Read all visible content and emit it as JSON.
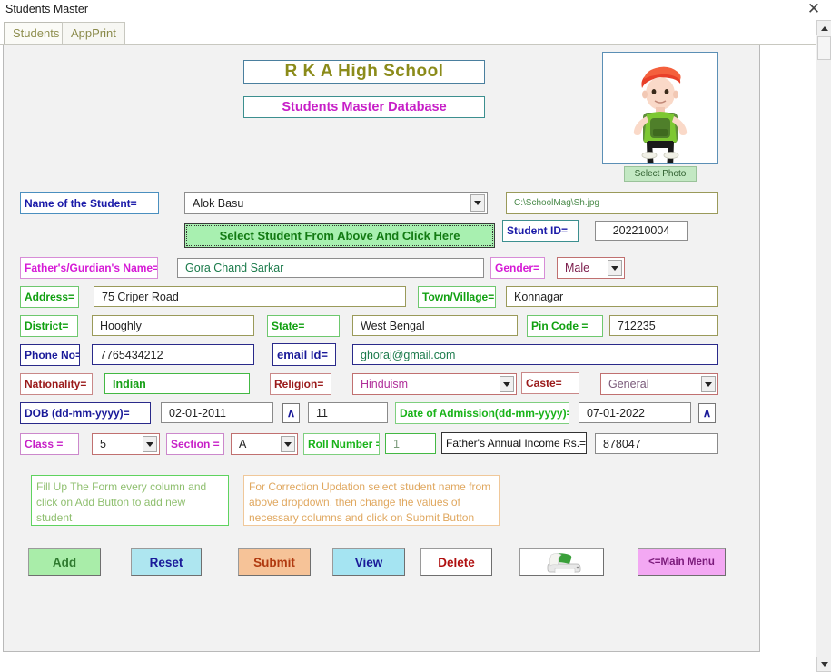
{
  "window": {
    "title": "Students Master",
    "close_icon": "close-icon"
  },
  "tabs": [
    {
      "label": "Students",
      "active": true
    },
    {
      "label": "AppPrint",
      "active": false
    }
  ],
  "header": {
    "school_name": "R K A High School",
    "subtitle": "Students Master Database"
  },
  "photo": {
    "select_photo_label": "Select Photo",
    "path_value": "C:\\SchoolMag\\Sh.jpg"
  },
  "form": {
    "name_label": "Name of the Student=",
    "name_value": "Alok Basu",
    "select_student_button": "Select Student From Above And Click Here",
    "student_id_label": "Student ID=",
    "student_id_value": "202210004",
    "father_label": "Father's/Gurdian's Name=",
    "father_value": "Gora Chand Sarkar",
    "gender_label": "Gender=",
    "gender_value": "Male",
    "address_label": "Address=",
    "address_value": "75 Criper Road",
    "town_label": "Town/Village=",
    "town_value": "Konnagar",
    "district_label": "District=",
    "district_value": "Hooghly",
    "state_label": "State=",
    "state_value": "West Bengal",
    "pin_label": "Pin Code =",
    "pin_value": "712235",
    "phone_label": "Phone No=",
    "phone_value": "7765434212",
    "email_label": "email Id=",
    "email_value": "ghoraj@gmail.com",
    "nationality_label": "Nationality=",
    "nationality_value": "Indian",
    "religion_label": "Religion=",
    "religion_value": "Hinduism",
    "caste_label": "Caste=",
    "caste_value": "General",
    "dob_label": "DOB (dd-mm-yyyy)=",
    "dob_value": "02-01-2011",
    "dob_picker_icon": "∧",
    "age_value": "11",
    "admission_label": "Date of Admission(dd-mm-yyyy)=",
    "admission_value": "07-01-2022",
    "admission_picker_icon": "∧",
    "class_label": "Class =",
    "class_value": "5",
    "section_label": "Section =",
    "section_value": "A",
    "roll_label": "Roll Number =",
    "roll_value": "1",
    "income_label": "Father's Annual Income Rs.=",
    "income_value": "878047"
  },
  "info": {
    "left_text": "Fill Up The Form every column and click on Add Button to add new student",
    "right_text": "For Correction Updation select student name from above dropdown, then change the values of necessary columns and click on Submit Button"
  },
  "buttons": {
    "add": "Add",
    "reset": "Reset",
    "submit": "Submit",
    "view": "View",
    "delete": "Delete",
    "print_icon": "printer-icon",
    "main_menu": "<=Main Menu"
  },
  "colors": {
    "title_olive": "#8b8b1a",
    "subtitle_magenta": "#c71fc7",
    "add_green": "#a9eda9",
    "reset_cyan": "#aee6f0",
    "submit_peach": "#f6c398",
    "view_cyan": "#a5e4f2",
    "mainmenu_pink": "#f3a8f3",
    "select_student_green": "#a8f0b0"
  }
}
